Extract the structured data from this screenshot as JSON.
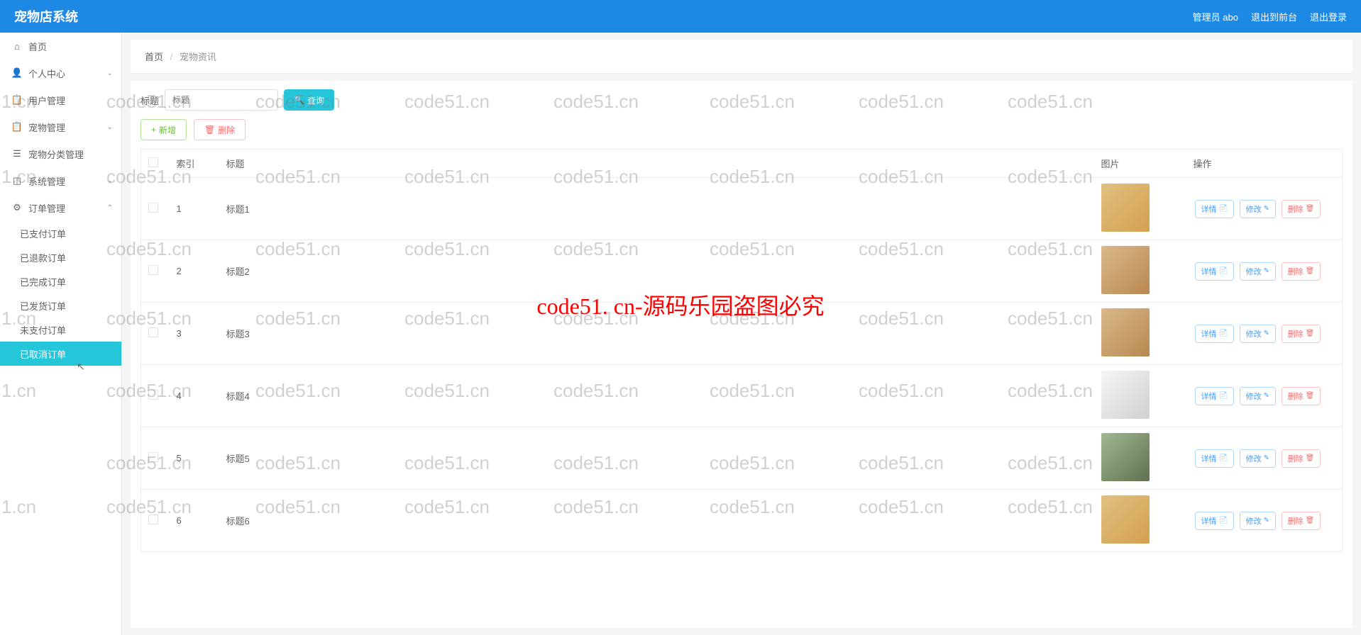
{
  "header": {
    "title": "宠物店系统",
    "user": "管理员 abo",
    "exit_front": "退出到前台",
    "logout": "退出登录"
  },
  "sidebar": {
    "home": "首页",
    "personal": "个人中心",
    "user_manage": "用户管理",
    "pet_manage": "宠物管理",
    "pet_category": "宠物分类管理",
    "system_manage": "系统管理",
    "order_manage": "订单管理",
    "orders": {
      "paid": "已支付订单",
      "refunded": "已退款订单",
      "completed": "已完成订单",
      "shipped": "已发货订单",
      "unpaid": "未支付订单",
      "cancelled": "已取消订单"
    }
  },
  "breadcrumb": {
    "home": "首页",
    "current": "宠物资讯"
  },
  "search": {
    "label": "标题",
    "placeholder": "标题",
    "button": "查询"
  },
  "actions": {
    "add": "新增",
    "delete": "删除"
  },
  "table": {
    "headers": {
      "index": "索引",
      "title": "标题",
      "image": "图片",
      "actions": "操作"
    },
    "rows": [
      {
        "index": "1",
        "title": "标题1"
      },
      {
        "index": "2",
        "title": "标题2"
      },
      {
        "index": "3",
        "title": "标题3"
      },
      {
        "index": "4",
        "title": "标题4"
      },
      {
        "index": "5",
        "title": "标题5"
      },
      {
        "index": "6",
        "title": "标题6"
      }
    ],
    "row_actions": {
      "detail": "详情",
      "edit": "修改",
      "delete": "删除"
    }
  },
  "watermark": {
    "center": "code51. cn-源码乐园盗图必究",
    "repeat": "code51.cn",
    "short": "1.cn"
  }
}
